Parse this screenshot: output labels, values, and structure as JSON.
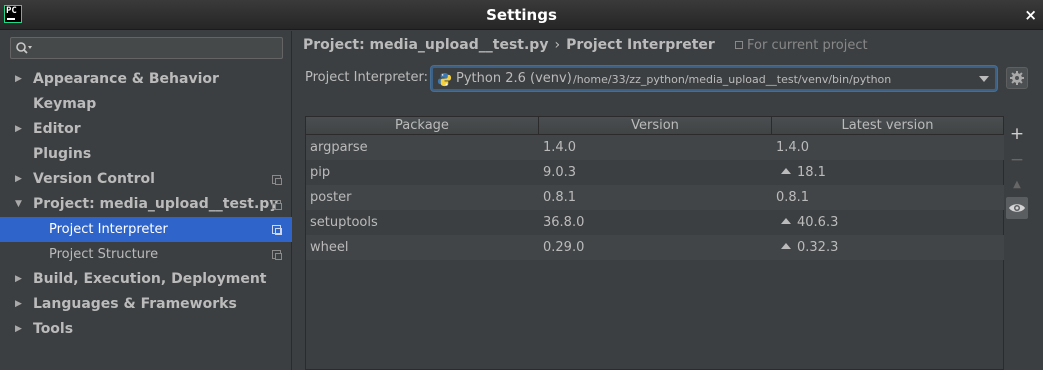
{
  "window": {
    "title": "Settings",
    "app_icon_text": "PC",
    "close_symbol": "×"
  },
  "sidebar": {
    "search": {
      "value": "",
      "placeholder": ""
    },
    "items": [
      {
        "label": "Appearance & Behavior",
        "arrow": "▶",
        "has_copy": false
      },
      {
        "label": "Keymap",
        "arrow": "",
        "has_copy": false
      },
      {
        "label": "Editor",
        "arrow": "▶",
        "has_copy": false
      },
      {
        "label": "Plugins",
        "arrow": "",
        "has_copy": false
      },
      {
        "label": "Version Control",
        "arrow": "▶",
        "has_copy": true
      },
      {
        "label": "Project: media_upload__test.py",
        "arrow": "▼",
        "has_copy": true
      },
      {
        "label": "Project Interpreter",
        "child": true,
        "selected": true,
        "has_copy": true
      },
      {
        "label": "Project Structure",
        "child": true,
        "has_copy": true
      },
      {
        "label": "Build, Execution, Deployment",
        "arrow": "▶",
        "has_copy": false
      },
      {
        "label": "Languages & Frameworks",
        "arrow": "▶",
        "has_copy": false
      },
      {
        "label": "Tools",
        "arrow": "▶",
        "has_copy": false
      }
    ]
  },
  "main": {
    "breadcrumb": {
      "project": "Project: media_upload__test.py",
      "separator": "›",
      "page": "Project Interpreter"
    },
    "scope_note": "For current project",
    "interpreter": {
      "label": "Project Interpreter:",
      "name": "Python 2.6 (venv)",
      "path": "/home/33/zz_python/media_upload__test/venv/bin/python"
    },
    "table": {
      "headers": [
        "Package",
        "Version",
        "Latest version"
      ],
      "rows": [
        {
          "package": "argparse",
          "version": "1.4.0",
          "latest": "1.4.0",
          "upgrade": false
        },
        {
          "package": "pip",
          "version": "9.0.3",
          "latest": "18.1",
          "upgrade": true
        },
        {
          "package": "poster",
          "version": "0.8.1",
          "latest": "0.8.1",
          "upgrade": false
        },
        {
          "package": "setuptools",
          "version": "36.8.0",
          "latest": "40.6.3",
          "upgrade": true
        },
        {
          "package": "wheel",
          "version": "0.29.0",
          "latest": "0.32.3",
          "upgrade": true
        }
      ]
    },
    "toolbar": {
      "add": "+",
      "remove": "−",
      "upgrade": "▲",
      "show_early": "eye-icon"
    }
  },
  "colors": {
    "background": "#3c3f41",
    "selection": "#2f65ca",
    "focus": "#466d94"
  }
}
